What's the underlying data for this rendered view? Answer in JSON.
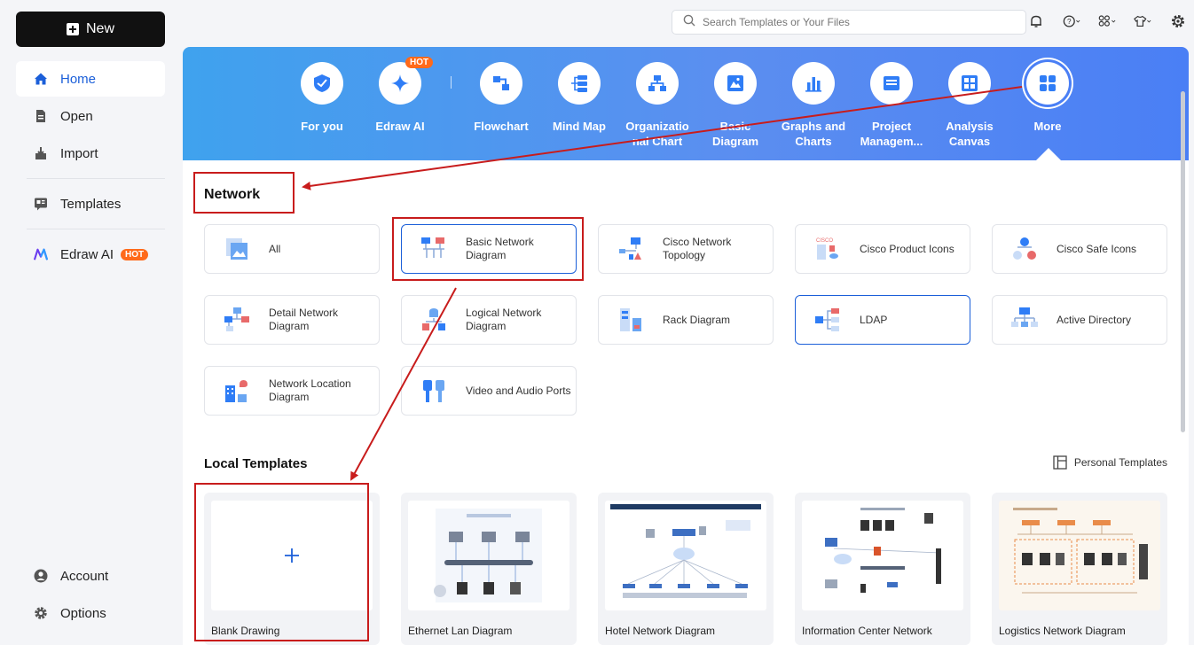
{
  "sidebar": {
    "new_label": "New",
    "items": [
      {
        "label": "Home"
      },
      {
        "label": "Open"
      },
      {
        "label": "Import"
      },
      {
        "label": "Templates"
      },
      {
        "label": "Edraw AI",
        "badge": "HOT"
      },
      {
        "label": "Account"
      },
      {
        "label": "Options"
      }
    ]
  },
  "topbar": {
    "search_placeholder": "Search Templates or Your Files"
  },
  "categories": [
    {
      "label": "For you"
    },
    {
      "label": "Edraw AI",
      "badge": "HOT"
    },
    {
      "label": "Flowchart"
    },
    {
      "label": "Mind Map"
    },
    {
      "label": "Organizatio nal Chart"
    },
    {
      "label": "Basic Diagram"
    },
    {
      "label": "Graphs and Charts"
    },
    {
      "label": "Project Managem..."
    },
    {
      "label": "Analysis Canvas"
    },
    {
      "label": "More"
    }
  ],
  "network": {
    "title": "Network",
    "items": [
      {
        "label": "All"
      },
      {
        "label": "Basic Network Diagram"
      },
      {
        "label": "Cisco Network Topology"
      },
      {
        "label": "Cisco Product Icons"
      },
      {
        "label": "Cisco Safe Icons"
      },
      {
        "label": "Detail Network Diagram"
      },
      {
        "label": "Logical Network Diagram"
      },
      {
        "label": "Rack Diagram"
      },
      {
        "label": "LDAP"
      },
      {
        "label": "Active Directory"
      },
      {
        "label": "Network Location Diagram"
      },
      {
        "label": "Video and Audio Ports"
      }
    ]
  },
  "local_templates": {
    "title": "Local Templates",
    "personal_label": "Personal Templates",
    "items": [
      {
        "label": "Blank Drawing"
      },
      {
        "label": "Ethernet Lan Diagram"
      },
      {
        "label": "Hotel Network Diagram"
      },
      {
        "label": "Information Center Network"
      },
      {
        "label": "Logistics Network Diagram"
      }
    ]
  },
  "colors": {
    "accent": "#1b5fd9",
    "banner": "#4a8ef2",
    "annotation": "#c81c1c",
    "hot": "#ff6a1a"
  }
}
